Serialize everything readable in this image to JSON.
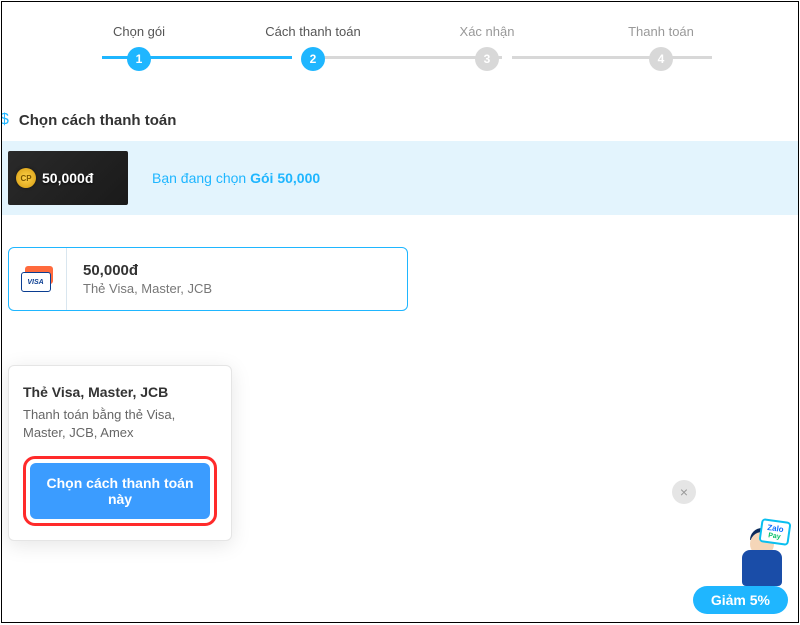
{
  "stepper": {
    "steps": [
      {
        "label": "Chọn gói",
        "num": "1"
      },
      {
        "label": "Cách thanh toán",
        "num": "2"
      },
      {
        "label": "Xác nhận",
        "num": "3"
      },
      {
        "label": "Thanh toán",
        "num": "4"
      }
    ]
  },
  "section": {
    "icon": "$",
    "title": "Chọn cách thanh toán"
  },
  "banner": {
    "pkg_price": "50,000đ",
    "prefix": "Bạn đang chọn ",
    "package": "Gói 50,000"
  },
  "pay_method": {
    "amount": "50,000đ",
    "desc": "Thẻ Visa, Master, JCB",
    "card_label": "VISA"
  },
  "panel": {
    "title": "Thẻ Visa, Master, JCB",
    "desc": "Thanh toán bằng thẻ Visa, Master, JCB, Amex",
    "cta": "Chọn cách thanh toán này"
  },
  "promo": {
    "brand_top": "Zalo",
    "brand_bot": "Pay",
    "discount": "Giảm 5%"
  }
}
